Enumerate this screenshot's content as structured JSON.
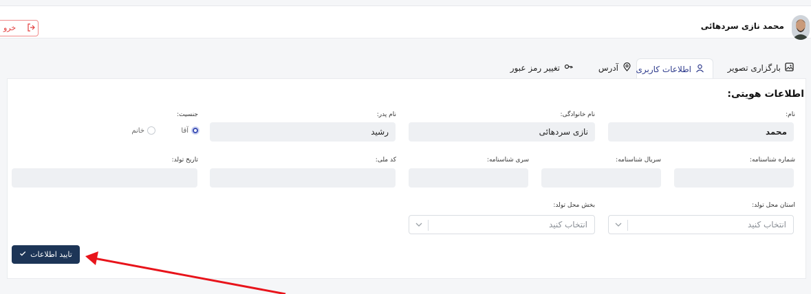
{
  "header": {
    "user_name": "محمد نازی سردهائی",
    "logout_label": "خرو"
  },
  "tabs": [
    {
      "label": "بارگزاری تصویر",
      "icon": "image-icon"
    },
    {
      "label": "اطلاعات کاربری",
      "icon": "user-icon",
      "active": true
    },
    {
      "label": "آدرس",
      "icon": "location-pin-icon"
    },
    {
      "label": "تغییر رمز عبور",
      "icon": "key-icon"
    }
  ],
  "form": {
    "section_title": "اطلاعات هویتی:",
    "first_name": {
      "label": "نام:",
      "value": "محمد"
    },
    "last_name": {
      "label": "نام خانوادگی:",
      "value": "نازی سردهائی"
    },
    "father_name": {
      "label": "نام پدر:",
      "value": "رشید"
    },
    "gender": {
      "label": "جنسیت:",
      "options": [
        "آقا",
        "خانم"
      ],
      "selected": "آقا"
    },
    "id_number": {
      "label": "شماره شناسنامه:",
      "value": ""
    },
    "id_serial": {
      "label": "سریال شناسنامه:",
      "value": ""
    },
    "id_series": {
      "label": "سری شناسنامه:",
      "value": ""
    },
    "national_code": {
      "label": "کد ملی:",
      "value": ""
    },
    "birth_date": {
      "label": "تاریخ تولد:",
      "value": ""
    },
    "birth_province": {
      "label": "استان محل تولد:",
      "placeholder": "انتخاب کنید"
    },
    "birth_district": {
      "label": "بخش محل تولد:",
      "placeholder": "انتخاب کنید"
    },
    "submit_label": "تایید اطلاعات"
  },
  "colors": {
    "primary": "#1d3557",
    "accent": "#3f51b5",
    "annotation_arrow": "#e8141b",
    "logout": "#e23d3d"
  }
}
